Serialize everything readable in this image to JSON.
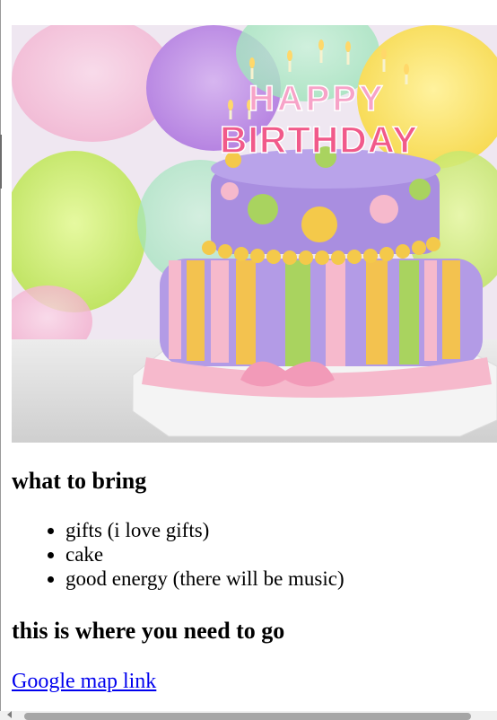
{
  "hero_image": {
    "alt": "birthday cake",
    "candle_text_line1": "HAPPY",
    "candle_text_line2": "BIRTHDAY"
  },
  "section_bring": {
    "heading": "what to bring",
    "items": [
      "gifts (i love gifts)",
      "cake",
      "good energy (there will be music)"
    ]
  },
  "section_go": {
    "heading": "this is where you need to go",
    "link_text": "Google map link"
  },
  "colors": {
    "link": "#0000ee",
    "cake_top": "#a98ee0",
    "ribbon": "#f6b9cc"
  }
}
